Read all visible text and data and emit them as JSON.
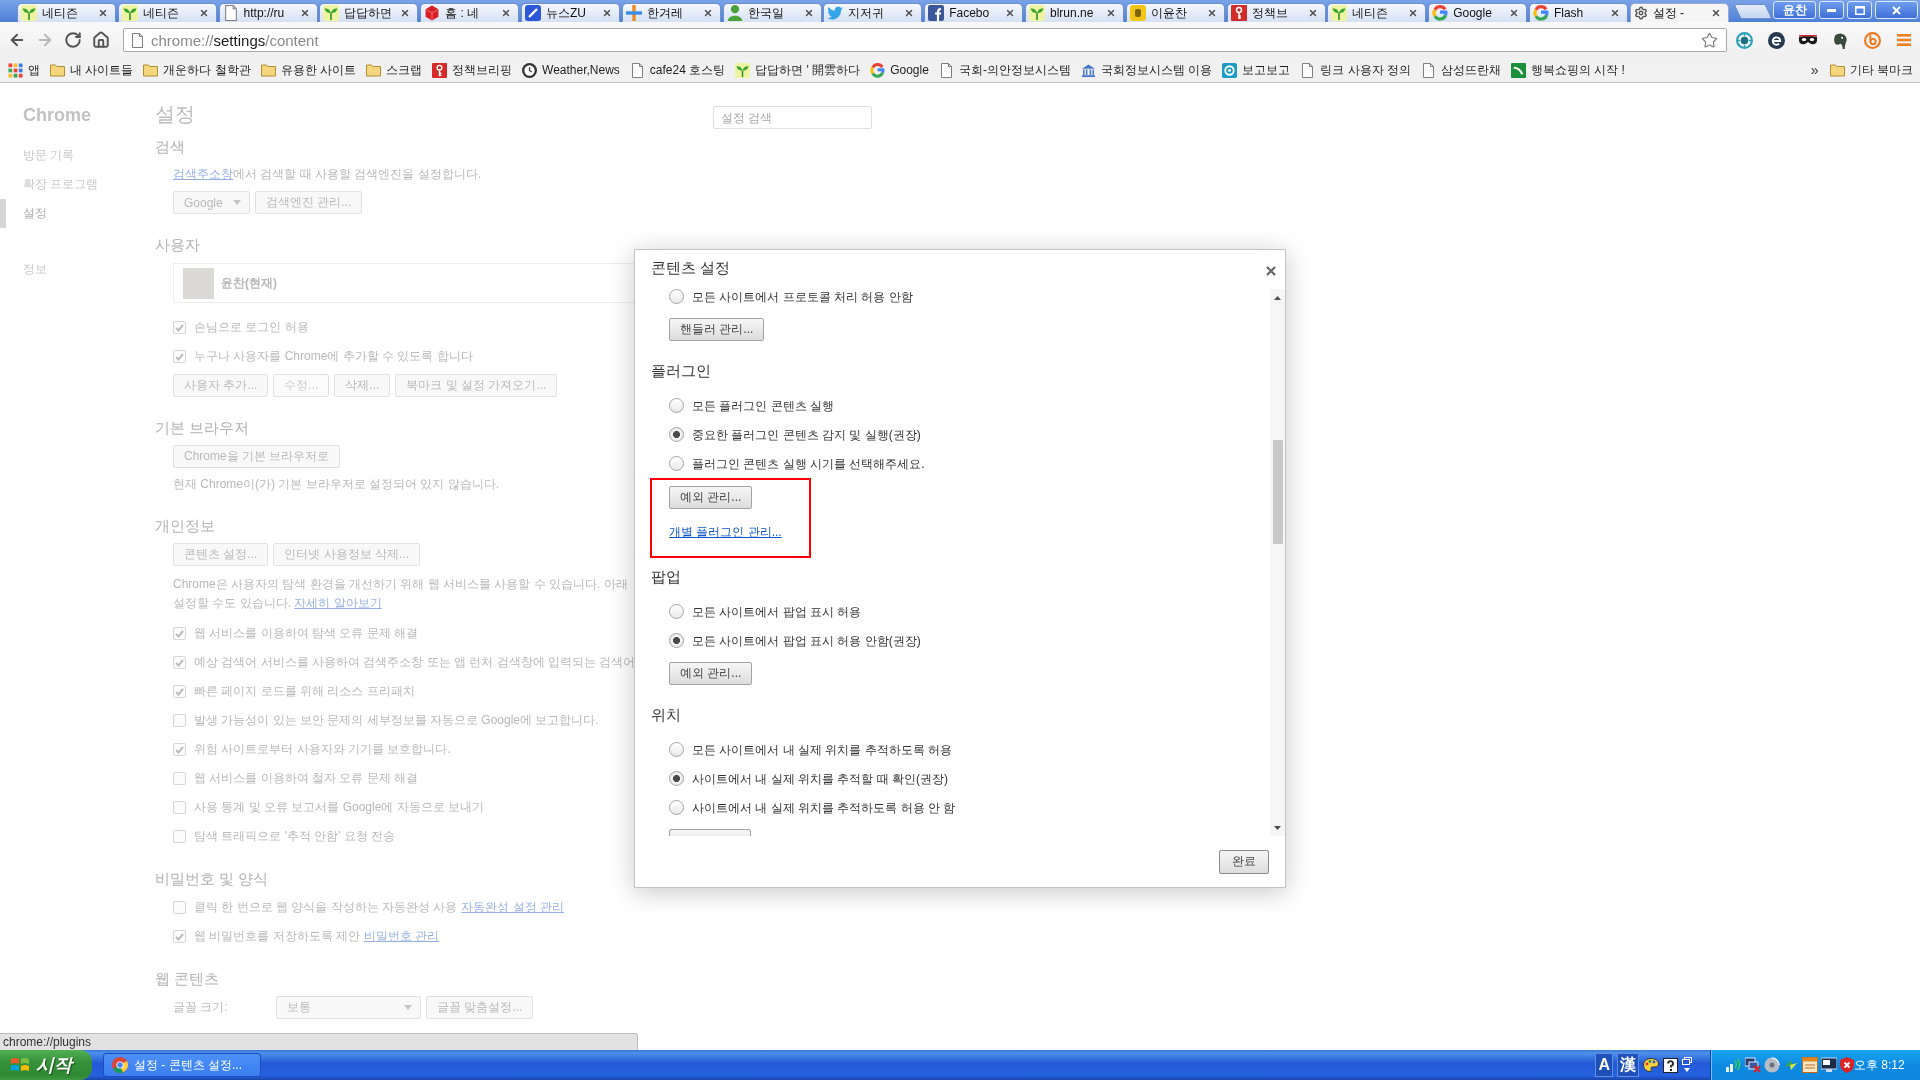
{
  "tabs": [
    {
      "title": "네티즌",
      "kind": "sprout",
      "selected": false
    },
    {
      "title": "네티즌",
      "kind": "sprout",
      "selected": false
    },
    {
      "title": "http://ru",
      "kind": "page",
      "selected": false
    },
    {
      "title": "답답하면",
      "kind": "sprout",
      "selected": false
    },
    {
      "title": "홈 : 네",
      "kind": "cube",
      "selected": false
    },
    {
      "title": "뉴스ZU",
      "kind": "tile",
      "selected": false
    },
    {
      "title": "한겨레",
      "kind": "plus",
      "selected": false
    },
    {
      "title": "한국일",
      "kind": "person",
      "selected": false
    },
    {
      "title": "지저귀",
      "kind": "bird",
      "selected": false
    },
    {
      "title": "Facebo",
      "kind": "square",
      "selected": false
    },
    {
      "title": "blrun.ne",
      "kind": "sprout",
      "selected": false
    },
    {
      "title": "이윤찬",
      "kind": "note",
      "selected": false
    },
    {
      "title": "정책브",
      "kind": "key",
      "selected": false
    },
    {
      "title": "네티즌",
      "kind": "sprout",
      "selected": false
    },
    {
      "title": "Google",
      "kind": "ring",
      "selected": false
    },
    {
      "title": "Flash",
      "kind": "ring",
      "selected": false
    },
    {
      "title": "설정 -",
      "kind": "gear",
      "selected": true
    }
  ],
  "window": {
    "profile": "윤찬"
  },
  "toolbar": {
    "nav": [
      {
        "kind": "back",
        "disabled": false
      },
      {
        "kind": "forward",
        "disabled": true
      },
      {
        "kind": "reload",
        "disabled": false
      },
      {
        "kind": "home",
        "disabled": false
      }
    ],
    "url": {
      "scheme": "chrome://",
      "host": "settings",
      "path": "/content"
    }
  },
  "bookmarks": {
    "items": [
      {
        "label": "앱",
        "kind": "apps"
      },
      {
        "label": "내 사이트들",
        "kind": "folder"
      },
      {
        "label": "개운하다 철학관",
        "kind": "folder"
      },
      {
        "label": "유용한 사이트",
        "kind": "folder"
      },
      {
        "label": "스크랩",
        "kind": "folder"
      },
      {
        "label": "정책브리핑",
        "kind": "key"
      },
      {
        "label": "Weather,News",
        "kind": "clock"
      },
      {
        "label": "cafe24 호스팅",
        "kind": "page"
      },
      {
        "label": "답답하면 ' 開雲하다",
        "kind": "sprout"
      },
      {
        "label": "Google",
        "kind": "ring"
      },
      {
        "label": "국회-의안정보시스템",
        "kind": "page"
      },
      {
        "label": "국회정보시스템 이용",
        "kind": "building"
      },
      {
        "label": "보고보고",
        "kind": "target"
      },
      {
        "label": "링크 사용자 정의",
        "kind": "page"
      },
      {
        "label": "삼성뜨란채",
        "kind": "page"
      },
      {
        "label": "행복쇼핑의 시작 !",
        "kind": "arrow"
      }
    ],
    "overflow": "»",
    "other": {
      "label": "기타 북마크",
      "kind": "folder"
    }
  },
  "sidebar": {
    "title": "Chrome",
    "items": [
      {
        "label": "방문 기록",
        "selected": false
      },
      {
        "label": "확장 프로그램",
        "selected": false
      },
      {
        "label": "설정",
        "selected": true
      }
    ],
    "more_items": [
      {
        "label": "정보",
        "selected": false
      }
    ]
  },
  "settings": {
    "title": "설정",
    "search": {
      "placeholder": "설정 검색"
    },
    "sections": [
      {
        "heading": "검색",
        "rows": [
          {
            "kind": "text",
            "parts": [
              {
                "text": "검색주소창",
                "link": true
              },
              {
                "text": "에서 검색할 때 사용할 검색엔진을 설정합니다.",
                "link": false
              }
            ]
          },
          {
            "kind": "controls",
            "items": [
              {
                "kind": "select",
                "label": "Google",
                "disabled": false
              },
              {
                "kind": "button",
                "label": "검색엔진 관리...",
                "disabled": false
              }
            ]
          }
        ]
      },
      {
        "heading": "사용자",
        "rows": [
          {
            "kind": "user",
            "name": "윤찬(현재)"
          },
          {
            "kind": "checkbox",
            "label": "손님으로 로그인 허용",
            "checked": true
          },
          {
            "kind": "checkbox",
            "label": "누구나 사용자를 Chrome에 추가할 수 있도록 합니다",
            "checked": true
          },
          {
            "kind": "controls",
            "items": [
              {
                "kind": "button",
                "label": "사용자 추가...",
                "disabled": false
              },
              {
                "kind": "button",
                "label": "수정...",
                "disabled": true
              },
              {
                "kind": "button",
                "label": "삭제...",
                "disabled": false
              },
              {
                "kind": "button",
                "label": "북마크 및 설정 가져오기...",
                "disabled": false
              }
            ]
          }
        ]
      },
      {
        "heading": "기본 브라우저",
        "rows": [
          {
            "kind": "controls",
            "items": [
              {
                "kind": "button",
                "label": "Chrome을 기본 브라우저로",
                "disabled": false
              }
            ]
          },
          {
            "kind": "text",
            "parts": [
              {
                "text": "현재 Chrome이(가) 기본 브라우저로 설정되어 있지 않습니다.",
                "link": false
              }
            ]
          }
        ]
      },
      {
        "heading": "개인정보",
        "rows": [
          {
            "kind": "controls",
            "items": [
              {
                "kind": "button",
                "label": "콘텐츠 설정...",
                "disabled": false
              },
              {
                "kind": "button",
                "label": "인터넷 사용정보 삭제...",
                "disabled": false
              }
            ]
          },
          {
            "kind": "paragraph",
            "lines": [
              {
                "parts": [
                  {
                    "text": "Chrome은 사용자의 탐색 환경을 개선하기 위해 웹 서비스를 사용할 수 있습니다. 아래",
                    "link": false
                  }
                ]
              },
              {
                "parts": [
                  {
                    "text": "설정할 수도 있습니다. ",
                    "link": false
                  },
                  {
                    "text": "자세히 알아보기",
                    "link": true
                  }
                ]
              }
            ]
          },
          {
            "kind": "checkbox",
            "label": "웹 서비스를 이용하여 탐색 오류 문제 해결",
            "checked": true
          },
          {
            "kind": "checkbox",
            "label": "예상 검색어 서비스를 사용하여 검색주소창 또는 앱 런처 검색창에 입력되는 검색어",
            "checked": true
          },
          {
            "kind": "checkbox",
            "label": "빠른 페이지 로드를 위해 리소스 프리패치",
            "checked": true
          },
          {
            "kind": "checkbox",
            "label": "발생 가능성이 있는 보안 문제의 세부정보를 자동으로 Google에 보고합니다.",
            "checked": false
          },
          {
            "kind": "checkbox",
            "label": "위험 사이트로부터 사용자와 기기를 보호합니다.",
            "checked": true
          },
          {
            "kind": "checkbox",
            "label": "웹 서비스를 이용하여 철자 오류 문제 해결",
            "checked": false
          },
          {
            "kind": "checkbox",
            "label": "사용 통계 및 오류 보고서를 Google에 자동으로 보내기",
            "checked": false
          },
          {
            "kind": "checkbox",
            "label": "탐색 트래픽으로 '추적 안함' 요청 전송",
            "checked": false
          }
        ]
      },
      {
        "heading": "비밀번호 및 양식",
        "rows": [
          {
            "kind": "checkbox",
            "label": "클릭 한 번으로 웹 양식을 작성하는 자동완성 사용",
            "link": "자동완성 설정 관리",
            "checked": false
          },
          {
            "kind": "checkbox",
            "label": "웹 비밀번호를 저장하도록 제안",
            "link": "비밀번호 관리",
            "checked": true
          }
        ]
      },
      {
        "heading": "웹 콘텐츠",
        "rows": [
          {
            "kind": "controls",
            "label": "글꼴 크기:",
            "items": [
              {
                "kind": "select",
                "label": "보통",
                "disabled": false
              },
              {
                "kind": "button",
                "label": "글꼴 맞춤설정...",
                "disabled": false
              }
            ]
          }
        ]
      }
    ]
  },
  "dialog": {
    "title": "콘텐츠 설정",
    "sections": [
      {
        "rows": [
          {
            "kind": "radio",
            "label": "모든 사이트에서 프로토콜 처리 허용 안함",
            "selected": false
          },
          {
            "kind": "button",
            "label": "핸들러 관리..."
          }
        ]
      },
      {
        "heading": "플러그인",
        "rows": [
          {
            "kind": "radio",
            "label": "모든 플러그인 콘텐츠 실행",
            "selected": false
          },
          {
            "kind": "radio",
            "label": "중요한 플러그인 콘텐츠 감지 및 실행(권장)",
            "selected": true
          },
          {
            "kind": "radio",
            "label": "플러그인 콘텐츠 실행 시기를 선택해주세요.",
            "selected": false
          },
          {
            "kind": "group",
            "highlighted": true,
            "rows": [
              {
                "kind": "button",
                "label": "예외 관리..."
              },
              {
                "kind": "link",
                "label": "개별 플러그인 관리..."
              }
            ]
          }
        ]
      },
      {
        "heading": "팝업",
        "rows": [
          {
            "kind": "radio",
            "label": "모든 사이트에서 팝업 표시 허용",
            "selected": false
          },
          {
            "kind": "radio",
            "label": "모든 사이트에서 팝업 표시 허용 안함(권장)",
            "selected": true
          },
          {
            "kind": "button",
            "label": "예외 관리..."
          }
        ]
      },
      {
        "heading": "위치",
        "rows": [
          {
            "kind": "radio",
            "label": "모든 사이트에서 내 실제 위치를 추적하도록 허용",
            "selected": false
          },
          {
            "kind": "radio",
            "label": "사이트에서 내 실제 위치를 추적할 때 확인(권장)",
            "selected": true
          },
          {
            "kind": "radio",
            "label": "사이트에서 내 실제 위치를 추적하도록 허용 안 함",
            "selected": false
          },
          {
            "kind": "cut_button"
          }
        ]
      }
    ],
    "done": "완료"
  },
  "status": {
    "url": "chrome://plugins"
  },
  "taskbar": {
    "start": "시작",
    "windows": [
      {
        "label": "설정 - 콘텐츠 설정..."
      }
    ],
    "language": [
      "A",
      "漢"
    ],
    "clock": "오후 8:12"
  }
}
